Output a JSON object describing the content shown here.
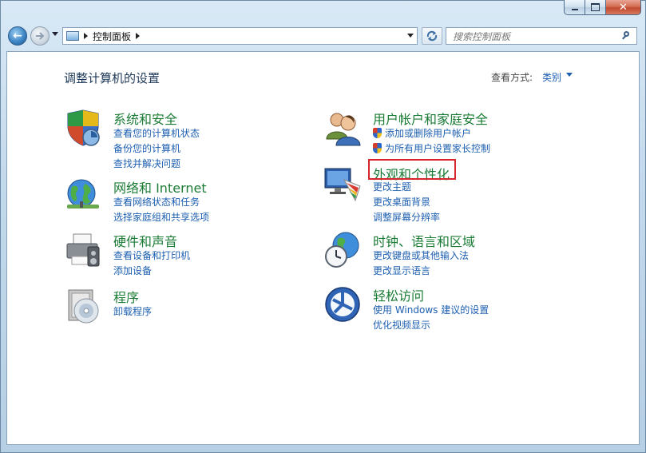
{
  "window": {
    "controls": {
      "close_glyph": "✕"
    }
  },
  "nav": {
    "back_glyph": "←",
    "address_path": "控制面板",
    "address_icon": "control-panel-icon",
    "search_placeholder": "搜索控制面板"
  },
  "content": {
    "title": "调整计算机的设置",
    "view_by_label": "查看方式:",
    "view_by_value": "类别",
    "categories": [
      {
        "icon": "shield-icon",
        "title": "系统和安全",
        "links": [
          "查看您的计算机状态",
          "备份您的计算机",
          "查找并解决问题"
        ]
      },
      {
        "icon": "network-globe-icon",
        "title": "网络和 Internet",
        "links": [
          "查看网络状态和任务",
          "选择家庭组和共享选项"
        ]
      },
      {
        "icon": "printer-icon",
        "title": "硬件和声音",
        "links": [
          "查看设备和打印机",
          "添加设备"
        ]
      },
      {
        "icon": "programs-disc-icon",
        "title": "程序",
        "links": [
          "卸载程序"
        ]
      },
      {
        "icon": "users-icon",
        "title": "用户帐户和家庭安全",
        "links": [
          "添加或删除用户帐户",
          "为所有用户设置家长控制"
        ]
      },
      {
        "icon": "display-palette-icon",
        "title": "外观和个性化",
        "links": [
          "更改主题",
          "更改桌面背景",
          "调整屏幕分辨率"
        ]
      },
      {
        "icon": "clock-globe-icon",
        "title": "时钟、语言和区域",
        "links": [
          "更改键盘或其他输入法",
          "更改显示语言"
        ]
      },
      {
        "icon": "ease-of-access-icon",
        "title": "轻松访问",
        "links": [
          "使用 Windows 建议的设置",
          "优化视频显示"
        ]
      }
    ]
  },
  "colors": {
    "category_title": "#1b7c36",
    "link": "#1d5fb0",
    "highlight": "#d7262b"
  }
}
